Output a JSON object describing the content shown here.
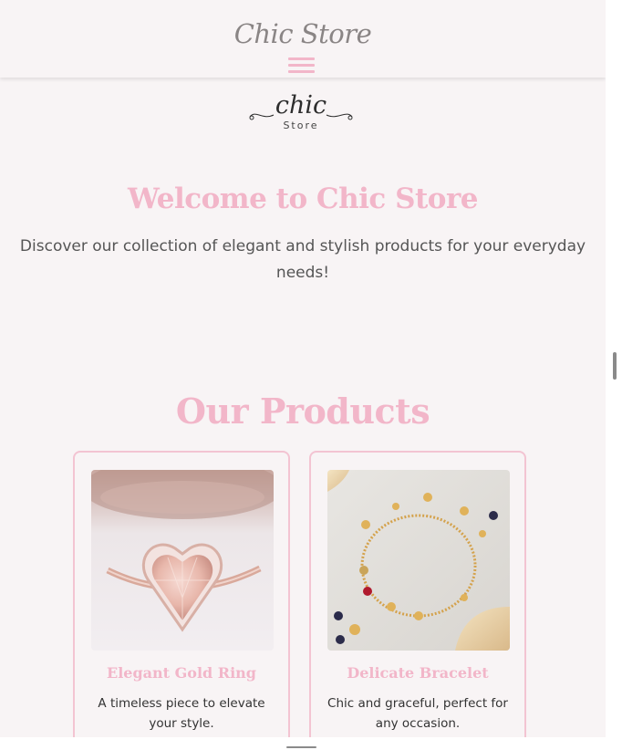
{
  "header": {
    "brand": "Chic Store",
    "menu_icon": "hamburger-menu-icon"
  },
  "logo": {
    "script": "chic",
    "sub": "Store"
  },
  "welcome": {
    "title": "Welcome to Chic Store",
    "text": "Discover our collection of elegant and stylish products for your everyday needs!"
  },
  "products": {
    "title": "Our Products",
    "items": [
      {
        "title": "Elegant Gold Ring",
        "description": "A timeless piece to elevate your style.",
        "image": "heart-ring-photo"
      },
      {
        "title": "Delicate Bracelet",
        "description": "Chic and graceful, perfect for any occasion.",
        "image": "charm-bracelet-photo"
      }
    ]
  },
  "colors": {
    "accent": "#f2b6c9",
    "background": "#f8f4f5",
    "text": "#555555"
  }
}
